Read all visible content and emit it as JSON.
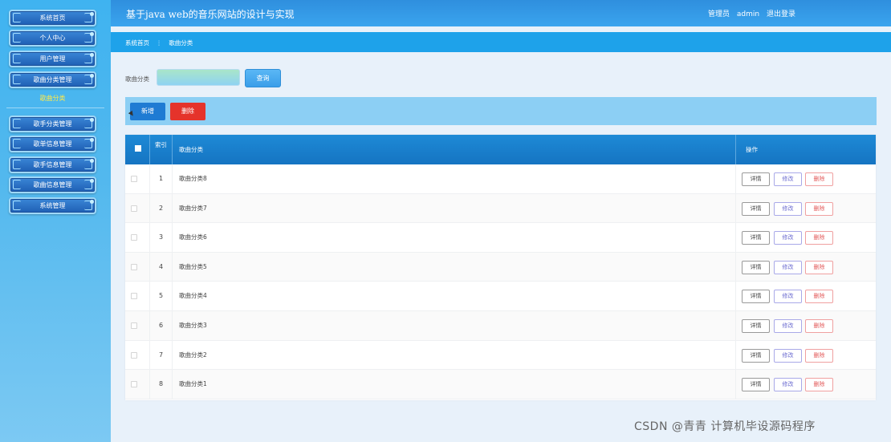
{
  "site": {
    "title": "基于java web的音乐网站的设计与实现"
  },
  "header": {
    "role": "管理员",
    "user": "admin",
    "logout": "退出登录"
  },
  "sidebar": {
    "items_top": [
      {
        "label": "系统首页"
      },
      {
        "label": "个人中心"
      },
      {
        "label": "用户管理"
      },
      {
        "label": "歌曲分类管理"
      }
    ],
    "submenu": {
      "label": "歌曲分类"
    },
    "items_bottom": [
      {
        "label": "歌手分类管理"
      },
      {
        "label": "歌单信息管理"
      },
      {
        "label": "歌手信息管理"
      },
      {
        "label": "歌曲信息管理"
      },
      {
        "label": "系统管理"
      }
    ]
  },
  "breadcrumb": {
    "home": "系统首页",
    "separator": "⋮",
    "current": "歌曲分类"
  },
  "search": {
    "label": "歌曲分类",
    "value": "",
    "placeholder": "",
    "button": "查询"
  },
  "toolbar": {
    "add": "新增",
    "delete": "删除"
  },
  "table": {
    "headers": {
      "index": "索引",
      "name": "歌曲分类",
      "ops": "操作"
    },
    "ops_labels": {
      "detail": "详情",
      "edit": "修改",
      "delete": "删除"
    },
    "rows": [
      {
        "index": "1",
        "name": "歌曲分类8"
      },
      {
        "index": "2",
        "name": "歌曲分类7"
      },
      {
        "index": "3",
        "name": "歌曲分类6"
      },
      {
        "index": "4",
        "name": "歌曲分类5"
      },
      {
        "index": "5",
        "name": "歌曲分类4"
      },
      {
        "index": "6",
        "name": "歌曲分类3"
      },
      {
        "index": "7",
        "name": "歌曲分类2"
      },
      {
        "index": "8",
        "name": "歌曲分类1"
      }
    ]
  },
  "watermark": "CSDN @青青  计算机毕设源码程序",
  "colors": {
    "sidebar": "#52b8ee",
    "header": "#2f8fde",
    "breadcrumb": "#1ea2ea",
    "table_header": "#1574c2",
    "add_button": "#1f7bd3",
    "delete_button": "#e5332b",
    "submenu_active": "#ffe94a"
  }
}
